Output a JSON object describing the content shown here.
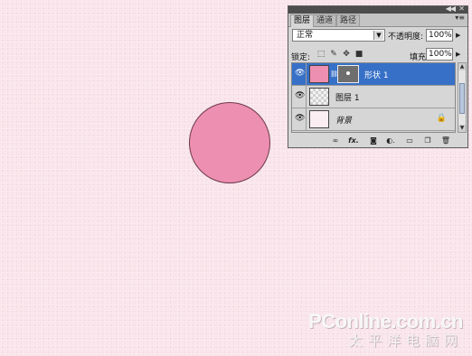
{
  "canvas": {
    "background_color": "#f9e4ea",
    "shape_fill_color": "#ed8fb0"
  },
  "panel": {
    "tabs": [
      {
        "label": "图层",
        "active": true
      },
      {
        "label": "通道",
        "active": false
      },
      {
        "label": "路径",
        "active": false
      }
    ],
    "blend_mode": "正常",
    "opacity_label": "不透明度:",
    "opacity_value": "100%",
    "lock_label": "锁定:",
    "fill_label": "填充:",
    "fill_value": "100%",
    "layers": [
      {
        "name": "形状 1",
        "selected": true,
        "visible": true
      },
      {
        "name": "图层 1",
        "selected": false,
        "visible": true
      },
      {
        "name": "背景",
        "selected": false,
        "visible": true,
        "locked": true
      }
    ],
    "footer_icons": [
      "link-icon",
      "fx-icon",
      "mask-icon",
      "adjustment-icon",
      "group-icon",
      "new-layer-icon",
      "trash-icon"
    ]
  },
  "watermark": {
    "top": "PConline.com.cn",
    "bottom": "太平洋电脑网"
  }
}
